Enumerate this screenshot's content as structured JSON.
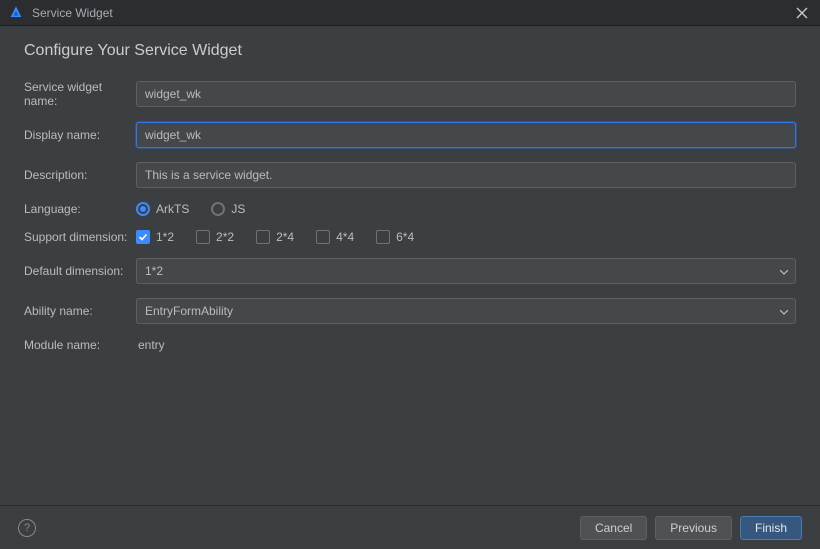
{
  "titlebar": {
    "title": "Service Widget"
  },
  "header": {
    "title": "Configure Your Service Widget"
  },
  "form": {
    "service_widget_name": {
      "label": "Service widget name:",
      "value": "widget_wk"
    },
    "display_name": {
      "label": "Display name:",
      "value": "widget_wk"
    },
    "description": {
      "label": "Description:",
      "value": "This is a service widget."
    },
    "language": {
      "label": "Language:",
      "options": [
        "ArkTS",
        "JS"
      ],
      "selected": "ArkTS"
    },
    "support_dimension": {
      "label": "Support dimension:",
      "options": [
        {
          "label": "1*2",
          "checked": true
        },
        {
          "label": "2*2",
          "checked": false
        },
        {
          "label": "2*4",
          "checked": false
        },
        {
          "label": "4*4",
          "checked": false
        },
        {
          "label": "6*4",
          "checked": false
        }
      ]
    },
    "default_dimension": {
      "label": "Default dimension:",
      "value": "1*2"
    },
    "ability_name": {
      "label": "Ability name:",
      "value": "EntryFormAbility"
    },
    "module_name": {
      "label": "Module name:",
      "value": "entry"
    }
  },
  "footer": {
    "cancel": "Cancel",
    "previous": "Previous",
    "finish": "Finish"
  }
}
